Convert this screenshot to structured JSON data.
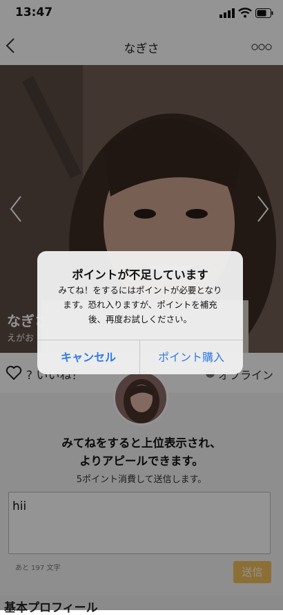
{
  "status_bar": {
    "time": "13:47"
  },
  "header": {
    "title": "なぎさ"
  },
  "photo": {
    "name": "なぎさ",
    "subtitle": "えがお"
  },
  "like_row": {
    "like_label": "? いいね！",
    "online_label": "オフライン"
  },
  "panel": {
    "headline_line1": "みてねをすると上位表示され、",
    "headline_line2": "よりアピールできます。",
    "cost_text": "5ポイント消費して送信します。",
    "message_value": "hii",
    "char_count": "あと 197 文字",
    "send_label": "送信"
  },
  "profile_section": {
    "title": "基本プロフィール"
  },
  "alert": {
    "title": "ポイントが不足しています",
    "message_line1": "みてね！をするにはポイントが必要となり",
    "message_line2": "ます。恐れ入りますが、ポイントを補充",
    "message_line3": "後、再度お試しください。",
    "cancel_label": "キャンセル",
    "buy_label": "ポイント購入"
  },
  "colors": {
    "accent": "#2f7ae5",
    "send_button": "#f2bf5d"
  }
}
